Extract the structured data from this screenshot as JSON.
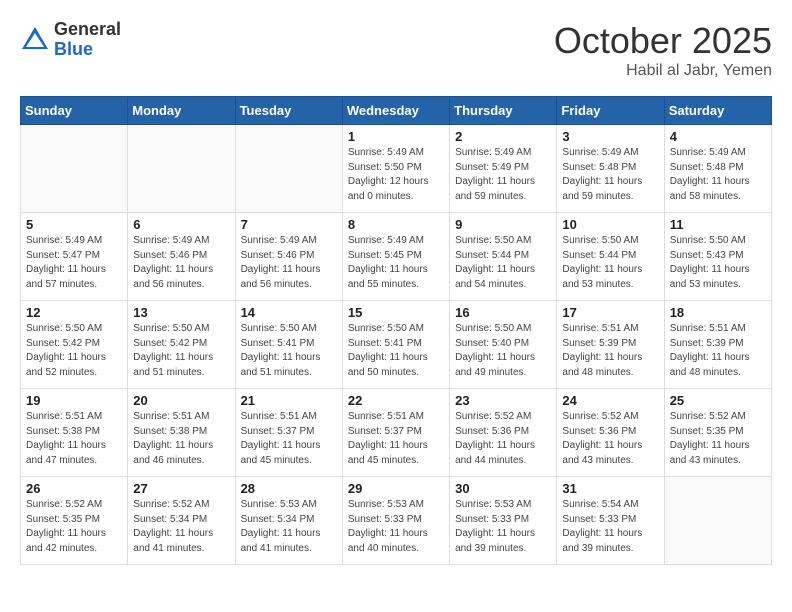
{
  "header": {
    "logo_general": "General",
    "logo_blue": "Blue",
    "month_title": "October 2025",
    "location": "Habil al Jabr, Yemen"
  },
  "weekdays": [
    "Sunday",
    "Monday",
    "Tuesday",
    "Wednesday",
    "Thursday",
    "Friday",
    "Saturday"
  ],
  "weeks": [
    [
      {
        "day": "",
        "info": ""
      },
      {
        "day": "",
        "info": ""
      },
      {
        "day": "",
        "info": ""
      },
      {
        "day": "1",
        "info": "Sunrise: 5:49 AM\nSunset: 5:50 PM\nDaylight: 12 hours\nand 0 minutes."
      },
      {
        "day": "2",
        "info": "Sunrise: 5:49 AM\nSunset: 5:49 PM\nDaylight: 11 hours\nand 59 minutes."
      },
      {
        "day": "3",
        "info": "Sunrise: 5:49 AM\nSunset: 5:48 PM\nDaylight: 11 hours\nand 59 minutes."
      },
      {
        "day": "4",
        "info": "Sunrise: 5:49 AM\nSunset: 5:48 PM\nDaylight: 11 hours\nand 58 minutes."
      }
    ],
    [
      {
        "day": "5",
        "info": "Sunrise: 5:49 AM\nSunset: 5:47 PM\nDaylight: 11 hours\nand 57 minutes."
      },
      {
        "day": "6",
        "info": "Sunrise: 5:49 AM\nSunset: 5:46 PM\nDaylight: 11 hours\nand 56 minutes."
      },
      {
        "day": "7",
        "info": "Sunrise: 5:49 AM\nSunset: 5:46 PM\nDaylight: 11 hours\nand 56 minutes."
      },
      {
        "day": "8",
        "info": "Sunrise: 5:49 AM\nSunset: 5:45 PM\nDaylight: 11 hours\nand 55 minutes."
      },
      {
        "day": "9",
        "info": "Sunrise: 5:50 AM\nSunset: 5:44 PM\nDaylight: 11 hours\nand 54 minutes."
      },
      {
        "day": "10",
        "info": "Sunrise: 5:50 AM\nSunset: 5:44 PM\nDaylight: 11 hours\nand 53 minutes."
      },
      {
        "day": "11",
        "info": "Sunrise: 5:50 AM\nSunset: 5:43 PM\nDaylight: 11 hours\nand 53 minutes."
      }
    ],
    [
      {
        "day": "12",
        "info": "Sunrise: 5:50 AM\nSunset: 5:42 PM\nDaylight: 11 hours\nand 52 minutes."
      },
      {
        "day": "13",
        "info": "Sunrise: 5:50 AM\nSunset: 5:42 PM\nDaylight: 11 hours\nand 51 minutes."
      },
      {
        "day": "14",
        "info": "Sunrise: 5:50 AM\nSunset: 5:41 PM\nDaylight: 11 hours\nand 51 minutes."
      },
      {
        "day": "15",
        "info": "Sunrise: 5:50 AM\nSunset: 5:41 PM\nDaylight: 11 hours\nand 50 minutes."
      },
      {
        "day": "16",
        "info": "Sunrise: 5:50 AM\nSunset: 5:40 PM\nDaylight: 11 hours\nand 49 minutes."
      },
      {
        "day": "17",
        "info": "Sunrise: 5:51 AM\nSunset: 5:39 PM\nDaylight: 11 hours\nand 48 minutes."
      },
      {
        "day": "18",
        "info": "Sunrise: 5:51 AM\nSunset: 5:39 PM\nDaylight: 11 hours\nand 48 minutes."
      }
    ],
    [
      {
        "day": "19",
        "info": "Sunrise: 5:51 AM\nSunset: 5:38 PM\nDaylight: 11 hours\nand 47 minutes."
      },
      {
        "day": "20",
        "info": "Sunrise: 5:51 AM\nSunset: 5:38 PM\nDaylight: 11 hours\nand 46 minutes."
      },
      {
        "day": "21",
        "info": "Sunrise: 5:51 AM\nSunset: 5:37 PM\nDaylight: 11 hours\nand 45 minutes."
      },
      {
        "day": "22",
        "info": "Sunrise: 5:51 AM\nSunset: 5:37 PM\nDaylight: 11 hours\nand 45 minutes."
      },
      {
        "day": "23",
        "info": "Sunrise: 5:52 AM\nSunset: 5:36 PM\nDaylight: 11 hours\nand 44 minutes."
      },
      {
        "day": "24",
        "info": "Sunrise: 5:52 AM\nSunset: 5:36 PM\nDaylight: 11 hours\nand 43 minutes."
      },
      {
        "day": "25",
        "info": "Sunrise: 5:52 AM\nSunset: 5:35 PM\nDaylight: 11 hours\nand 43 minutes."
      }
    ],
    [
      {
        "day": "26",
        "info": "Sunrise: 5:52 AM\nSunset: 5:35 PM\nDaylight: 11 hours\nand 42 minutes."
      },
      {
        "day": "27",
        "info": "Sunrise: 5:52 AM\nSunset: 5:34 PM\nDaylight: 11 hours\nand 41 minutes."
      },
      {
        "day": "28",
        "info": "Sunrise: 5:53 AM\nSunset: 5:34 PM\nDaylight: 11 hours\nand 41 minutes."
      },
      {
        "day": "29",
        "info": "Sunrise: 5:53 AM\nSunset: 5:33 PM\nDaylight: 11 hours\nand 40 minutes."
      },
      {
        "day": "30",
        "info": "Sunrise: 5:53 AM\nSunset: 5:33 PM\nDaylight: 11 hours\nand 39 minutes."
      },
      {
        "day": "31",
        "info": "Sunrise: 5:54 AM\nSunset: 5:33 PM\nDaylight: 11 hours\nand 39 minutes."
      },
      {
        "day": "",
        "info": ""
      }
    ]
  ]
}
